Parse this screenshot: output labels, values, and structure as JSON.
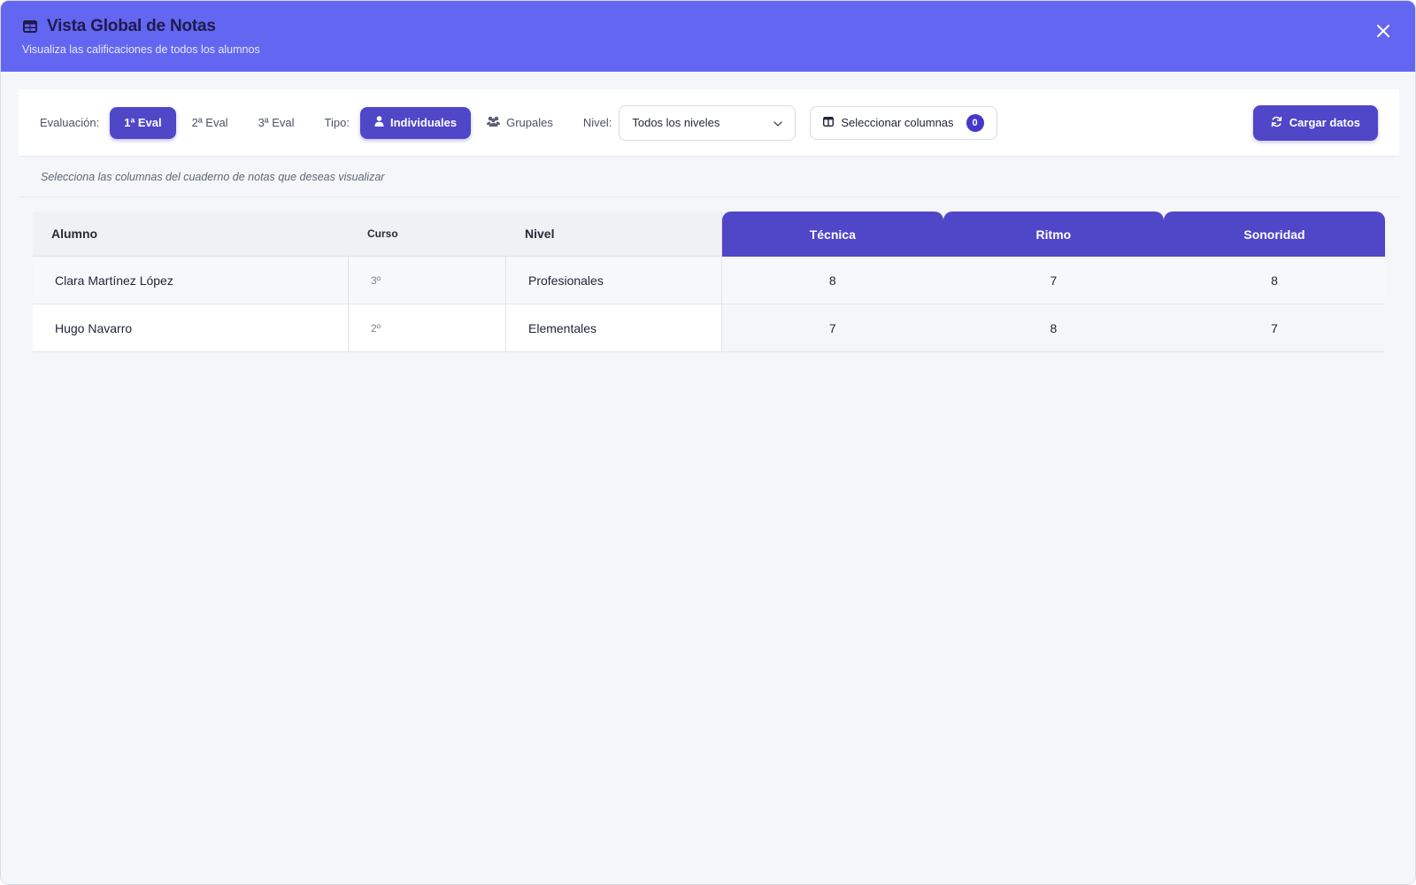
{
  "header": {
    "title": "Vista Global de Notas",
    "subtitle": "Visualiza las calificaciones de todos los alumnos",
    "title_icon": "table-icon",
    "close_icon": "close-icon"
  },
  "toolbar": {
    "evaluacion_label": "Evaluación:",
    "eval_options": [
      "1ª Eval",
      "2ª Eval",
      "3ª Eval"
    ],
    "eval_selected": "1ª Eval",
    "tipo_label": "Tipo:",
    "tipo_options": [
      "Individuales",
      "Grupales"
    ],
    "tipo_selected": "Individuales",
    "nivel_label": "Nivel:",
    "nivel_value": "Todos los niveles",
    "columns_button": "Seleccionar columnas",
    "columns_count": "0",
    "load_button": "Cargar datos"
  },
  "hint": "Selecciona las columnas del cuaderno de notas que deseas visualizar",
  "table": {
    "headers": {
      "alumno": "Alumno",
      "curso": "Curso",
      "nivel": "Nivel",
      "grades": [
        "Técnica",
        "Ritmo",
        "Sonoridad"
      ]
    },
    "rows": [
      {
        "alumno": "Clara Martínez López",
        "curso": "3º",
        "nivel": "Profesionales",
        "grades": [
          "8",
          "7",
          "8"
        ]
      },
      {
        "alumno": "Hugo Navarro",
        "curso": "2º",
        "nivel": "Elementales",
        "grades": [
          "7",
          "8",
          "7"
        ]
      }
    ]
  },
  "colors": {
    "header_bg": "#6366f1",
    "accent": "#5046c8",
    "page_bg": "#f4f6fa"
  }
}
